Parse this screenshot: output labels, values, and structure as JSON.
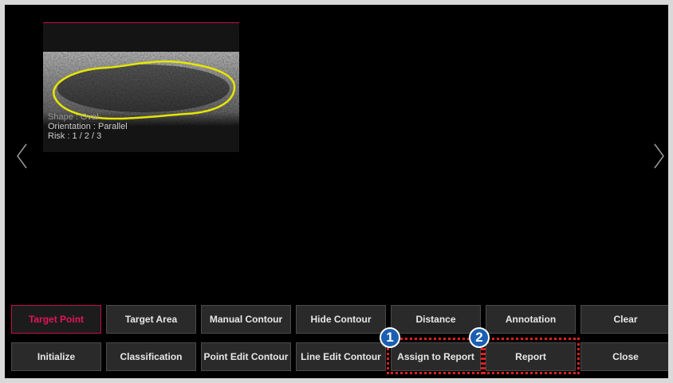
{
  "thumbnail": {
    "shape": "Shape : Oval",
    "orientation": "Orientation : Parallel",
    "risk": "Risk : 1 / 2 / 3"
  },
  "toolbar": {
    "row1": [
      "Target Point",
      "Target Area",
      "Manual Contour",
      "Hide Contour",
      "Distance",
      "Annotation",
      "Clear"
    ],
    "row2": [
      "Initialize",
      "Classification",
      "Point Edit Contour",
      "Line Edit Contour",
      "Assign to Report",
      "Report",
      "Close"
    ],
    "active": "Target Point"
  },
  "callouts": {
    "badge1": "1",
    "badge2": "2",
    "color": "#e02020",
    "badge_color": "#1b5fb3"
  },
  "icons": {
    "prev": "chevron-left-icon",
    "next": "chevron-right-icon"
  },
  "colors": {
    "accent": "#e4145a",
    "contour": "#e6e600"
  }
}
